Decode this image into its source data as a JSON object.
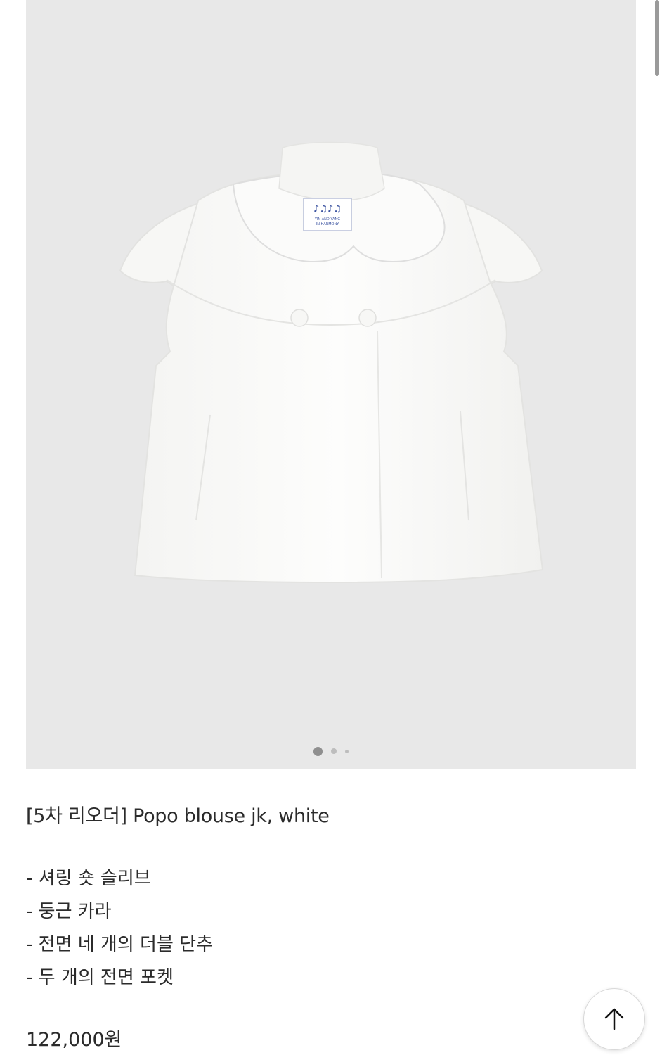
{
  "gallery": {
    "image_label": "YIN AND YANG IN HARMONY",
    "dots_count": 3,
    "active_dot": 0
  },
  "product": {
    "title": "[5차 리오더] Popo blouse jk, white",
    "features": [
      "- 셔링 숏 슬리브",
      "- 둥근 카라",
      "- 전면 네 개의 더블 단추",
      "- 두 개의 전면 포켓"
    ],
    "price": "122,000원"
  },
  "icons": {
    "scroll_top": "arrow-up-icon"
  }
}
